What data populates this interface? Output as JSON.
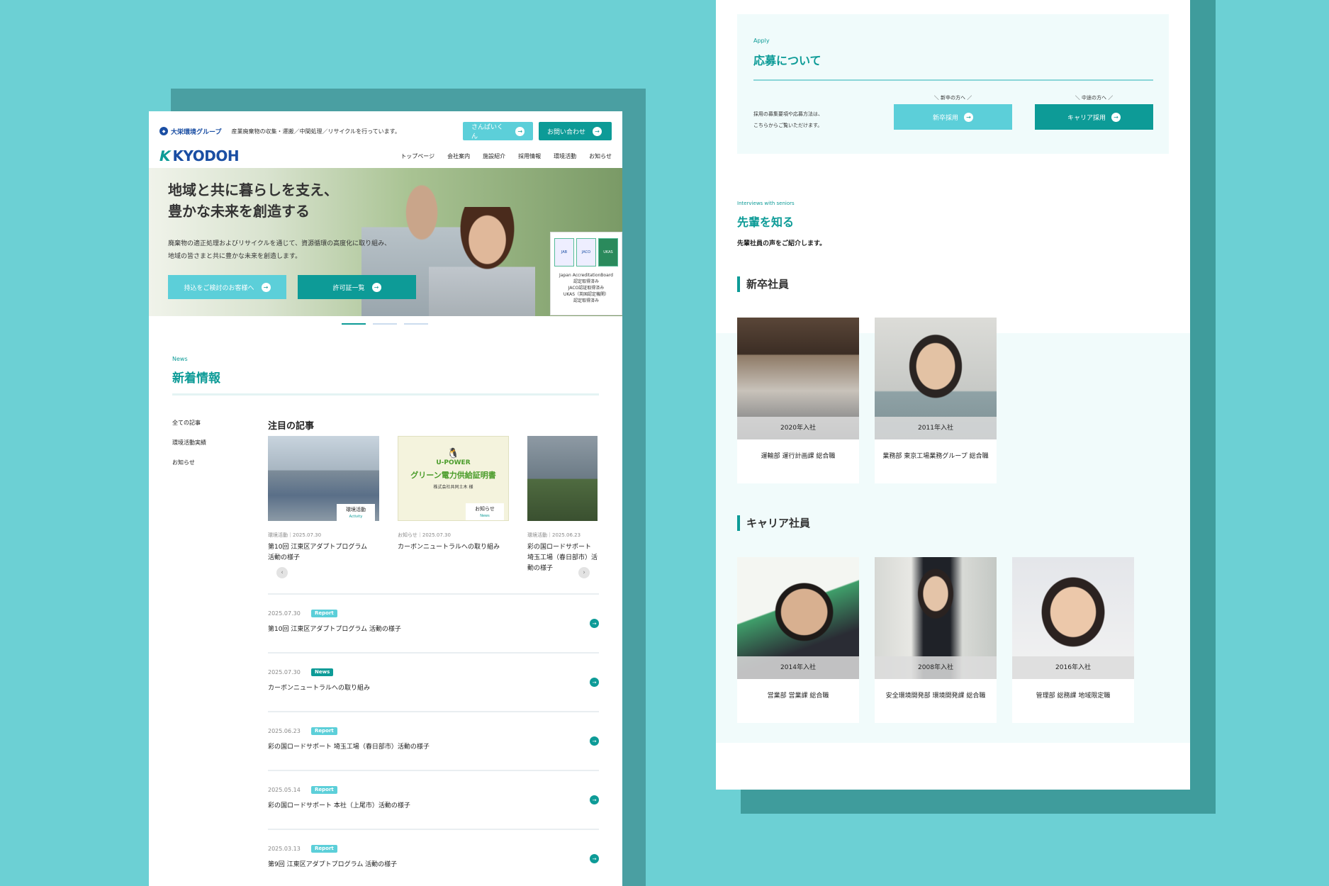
{
  "colors": {
    "teal": "#0d9b97",
    "light_teal": "#5ccfd9",
    "navy": "#1a4ea3",
    "bg": "#6cd0d4"
  },
  "left": {
    "group_logo": "大栄環境グループ",
    "group_desc": "産業廃棄物の収集・運搬／中間処理／リサイクルを行っています。",
    "btn_sanpai": "さんぱいくん",
    "btn_contact": "お問い合わせ",
    "brand": "KYODOH",
    "nav": [
      "トップページ",
      "会社案内",
      "施設紹介",
      "採用情報",
      "環境活動",
      "お知らせ"
    ],
    "hero": {
      "line1": "地域と共に暮らしを支え、",
      "line2": "豊かな未来を創造する",
      "p1": "廃棄物の適正処理およびリサイクルを通じて、資源循環の高度化に取り組み、",
      "p2": "地域の皆さまと共に豊かな未来を創造します。",
      "btn1": "持込をご検討のお客様へ",
      "btn2": "許可証一覧",
      "cert_lines": [
        "Japan AccreditationBoard",
        "認定取得済み",
        "JACO認証取得済み",
        "UKAS（英国認定機関）",
        "認定取得済み"
      ],
      "cert_logo1": "JAB",
      "cert_logo2": "JACO",
      "cert_logo3": "UKAS"
    },
    "news": {
      "label": "News",
      "title": "新着情報",
      "side": [
        "全ての記事",
        "環境活動実績",
        "お知らせ"
      ],
      "featured_title": "注目の記事",
      "cards": [
        {
          "tag": "環境活動",
          "tag_en": "Activity",
          "meta": "環境活動｜2025.07.30",
          "title": "第10回 江東区アダプトプログラム 活動の様子"
        },
        {
          "tag": "お知らせ",
          "tag_en": "News",
          "meta": "お知らせ｜2025.07.30",
          "title": "カーボンニュートラルへの取り組み",
          "img_brand": "U-POWER",
          "img_title": "グリーン電力供給証明書",
          "img_sub": "株式会社共同土木 様"
        },
        {
          "meta": "環境活動｜2025.06.23",
          "title": "彩の国ロードサポート 埼玉工場（春日部市）活動の様子"
        }
      ],
      "list": [
        {
          "date": "2025.07.30",
          "badge": "Report",
          "title": "第10回 江東区アダプトプログラム 活動の様子"
        },
        {
          "date": "2025.07.30",
          "badge": "News",
          "title": "カーボンニュートラルへの取り組み"
        },
        {
          "date": "2025.06.23",
          "badge": "Report",
          "title": "彩の国ロードサポート 埼玉工場（春日部市）活動の様子"
        },
        {
          "date": "2025.05.14",
          "badge": "Report",
          "title": "彩の国ロードサポート 本社（上尾市）活動の様子"
        },
        {
          "date": "2025.03.13",
          "badge": "Report",
          "title": "第9回 江東区アダプトプログラム 活動の様子"
        }
      ]
    }
  },
  "right": {
    "apply": {
      "label": "Apply",
      "title": "応募について",
      "desc1": "採用の募集要項や応募方法は、",
      "desc2": "こちらからご覧いただけます。",
      "new_label": "＼ 新卒の方へ ／",
      "new_btn": "新卒採用",
      "mid_label": "＼ 中途の方へ ／",
      "mid_btn": "キャリア採用"
    },
    "interviews": {
      "label": "Interviews with seniors",
      "title": "先輩を知る",
      "desc": "先輩社員の声をご紹介します。",
      "new_grad_heading": "新卒社員",
      "career_heading": "キャリア社員",
      "new_grads": [
        {
          "year": "2020年入社",
          "role": "運輸部 運行計画課 総合職"
        },
        {
          "year": "2011年入社",
          "role": "業務部 東京工場業務グループ 総合職"
        }
      ],
      "careers": [
        {
          "year": "2014年入社",
          "role": "営業部 営業課 総合職"
        },
        {
          "year": "2008年入社",
          "role": "安全環境開発部 環境開発課 総合職"
        },
        {
          "year": "2016年入社",
          "role": "管理部 総務課 地域限定職"
        }
      ]
    }
  }
}
